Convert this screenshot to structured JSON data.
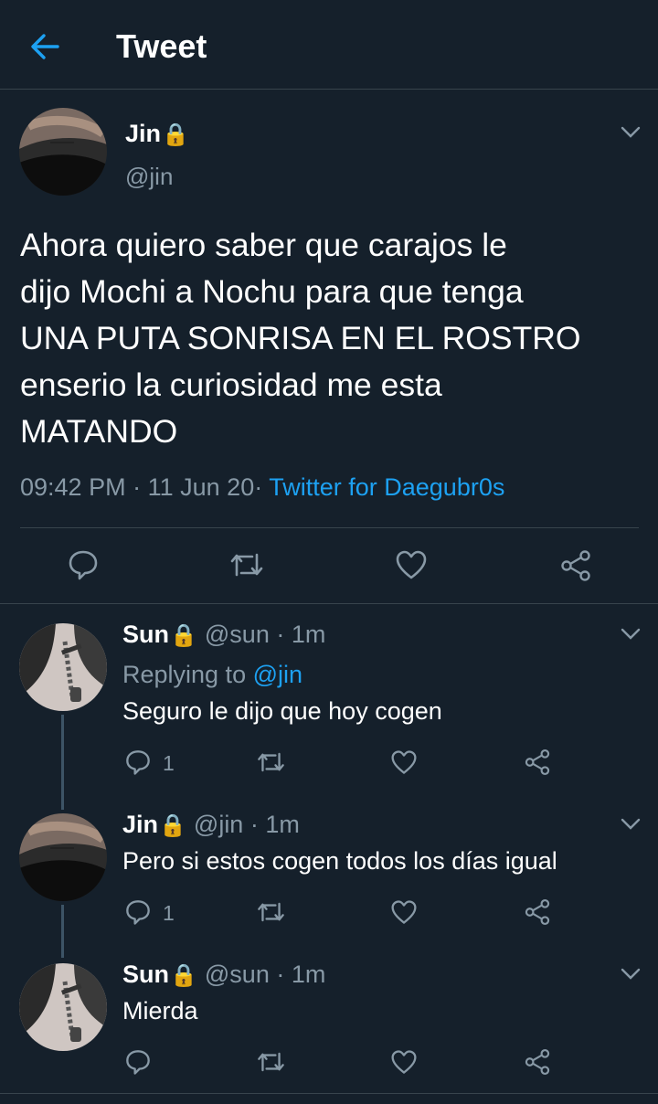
{
  "header": {
    "title": "Tweet"
  },
  "main_tweet": {
    "name": "Jin",
    "lock": "🔒",
    "handle": "@jin",
    "text": "Ahora quiero saber que carajos le\ndijo Mochi a Nochu para que tenga\nUNA PUTA SONRISA EN EL ROSTRO\nenserio la curiosidad me esta\nMATANDO",
    "time": "09:42 PM",
    "date": "11 Jun 20",
    "sep": "·",
    "source": "Twitter for Daegubr0s"
  },
  "replies": [
    {
      "name": "Sun",
      "lock": "🔒",
      "handle": "@sun · 1m",
      "replying_label": "Replying to",
      "replying_to": "@jin",
      "text": "Seguro le dijo que hoy cogen",
      "reply_count": "1"
    },
    {
      "name": "Jin",
      "lock": "🔒",
      "handle": "@jin · 1m",
      "text": "Pero si estos cogen todos los días igual",
      "reply_count": "1"
    },
    {
      "name": "Sun",
      "lock": "🔒",
      "handle": "@sun · 1m",
      "text": "Mierda",
      "reply_count": ""
    }
  ],
  "colors": {
    "background": "#15202b",
    "accent": "#1da1f2",
    "secondary_text": "#8899a6",
    "divider": "#38444d"
  },
  "icons": [
    "back-arrow-icon",
    "chevron-down-icon",
    "reply-icon",
    "retweet-icon",
    "like-icon",
    "share-icon",
    "lock-icon"
  ]
}
